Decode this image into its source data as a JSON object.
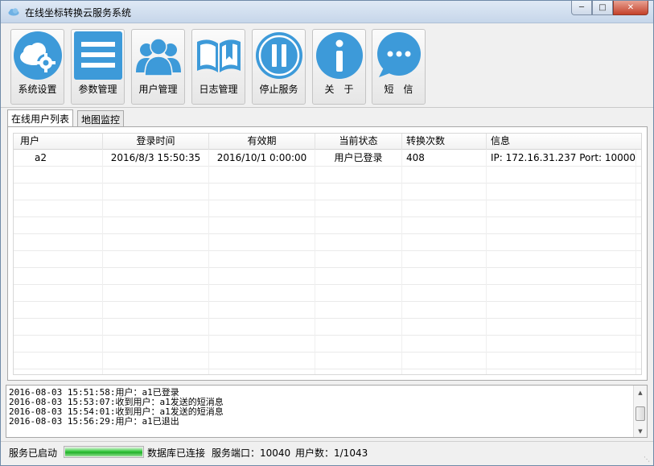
{
  "window": {
    "title": "在线坐标转换云服务系统"
  },
  "toolbar": {
    "buttons": [
      {
        "label": "系统设置",
        "icon": "cloud-gear-icon"
      },
      {
        "label": "参数管理",
        "icon": "list-icon"
      },
      {
        "label": "用户管理",
        "icon": "users-icon"
      },
      {
        "label": "日志管理",
        "icon": "book-icon"
      },
      {
        "label": "停止服务",
        "icon": "pause-icon"
      },
      {
        "label": "关　于",
        "icon": "info-icon"
      },
      {
        "label": "短　信",
        "icon": "chat-icon"
      }
    ],
    "icon_color": "#3d9ad9"
  },
  "tabs": [
    {
      "label": "在线用户列表",
      "active": true
    },
    {
      "label": "地图监控",
      "active": false
    }
  ],
  "grid": {
    "columns": [
      "用户",
      "登录时间",
      "有效期",
      "当前状态",
      "转换次数",
      "信息"
    ],
    "rows": [
      [
        "a2",
        "2016/8/3 15:50:35",
        "2016/10/1 0:00:00",
        "用户已登录",
        "408",
        "IP: 172.16.31.237 Port: 10000"
      ]
    ]
  },
  "log": {
    "lines": [
      "2016-08-03 15:51:58:用户：a1已登录",
      "2016-08-03 15:53:07:收到用户：a1发送的短消息",
      "2016-08-03 15:54:01:收到用户：a1发送的短消息",
      "2016-08-03 15:56:29:用户：a1已退出"
    ]
  },
  "status": {
    "service_state": "服务已启动",
    "progress_fraction": 1.0,
    "db_state": "数据库已连接",
    "port_text": "服务端口：10040",
    "user_count_text": "用户数：1/1043",
    "progress_color": "#2fbf38"
  }
}
